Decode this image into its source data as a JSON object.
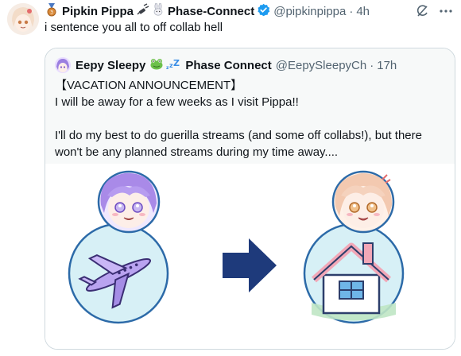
{
  "tweet": {
    "display_name": "Pipkin Pippa",
    "name_suffix": "Phase-Connect",
    "handle": "@pipkinpippa",
    "separator": "·",
    "time": "4h",
    "text": "i sentence you all to off collab hell"
  },
  "quote": {
    "display_name": "Eepy Sleepy",
    "name_suffix": "Phase Connect",
    "handle": "@EepySleepyCh",
    "separator": "·",
    "time": "17h",
    "lines": [
      "【VACATION ANNOUNCEMENT】",
      "I will be away for a few weeks as I visit Pippa!!",
      "I'll do my best to do guerilla streams (and some off collabs!), but there",
      "won't be any planned streams during my time away...."
    ]
  },
  "icons": {
    "verified_color": "#1d9bf0",
    "arrow_color": "#1e3a7b",
    "circle_fill": "#d7f0f6",
    "circle_stroke": "#2c6aa8",
    "plane_color": "#b9a3f0",
    "house_roof_color": "#f2a7b7"
  }
}
